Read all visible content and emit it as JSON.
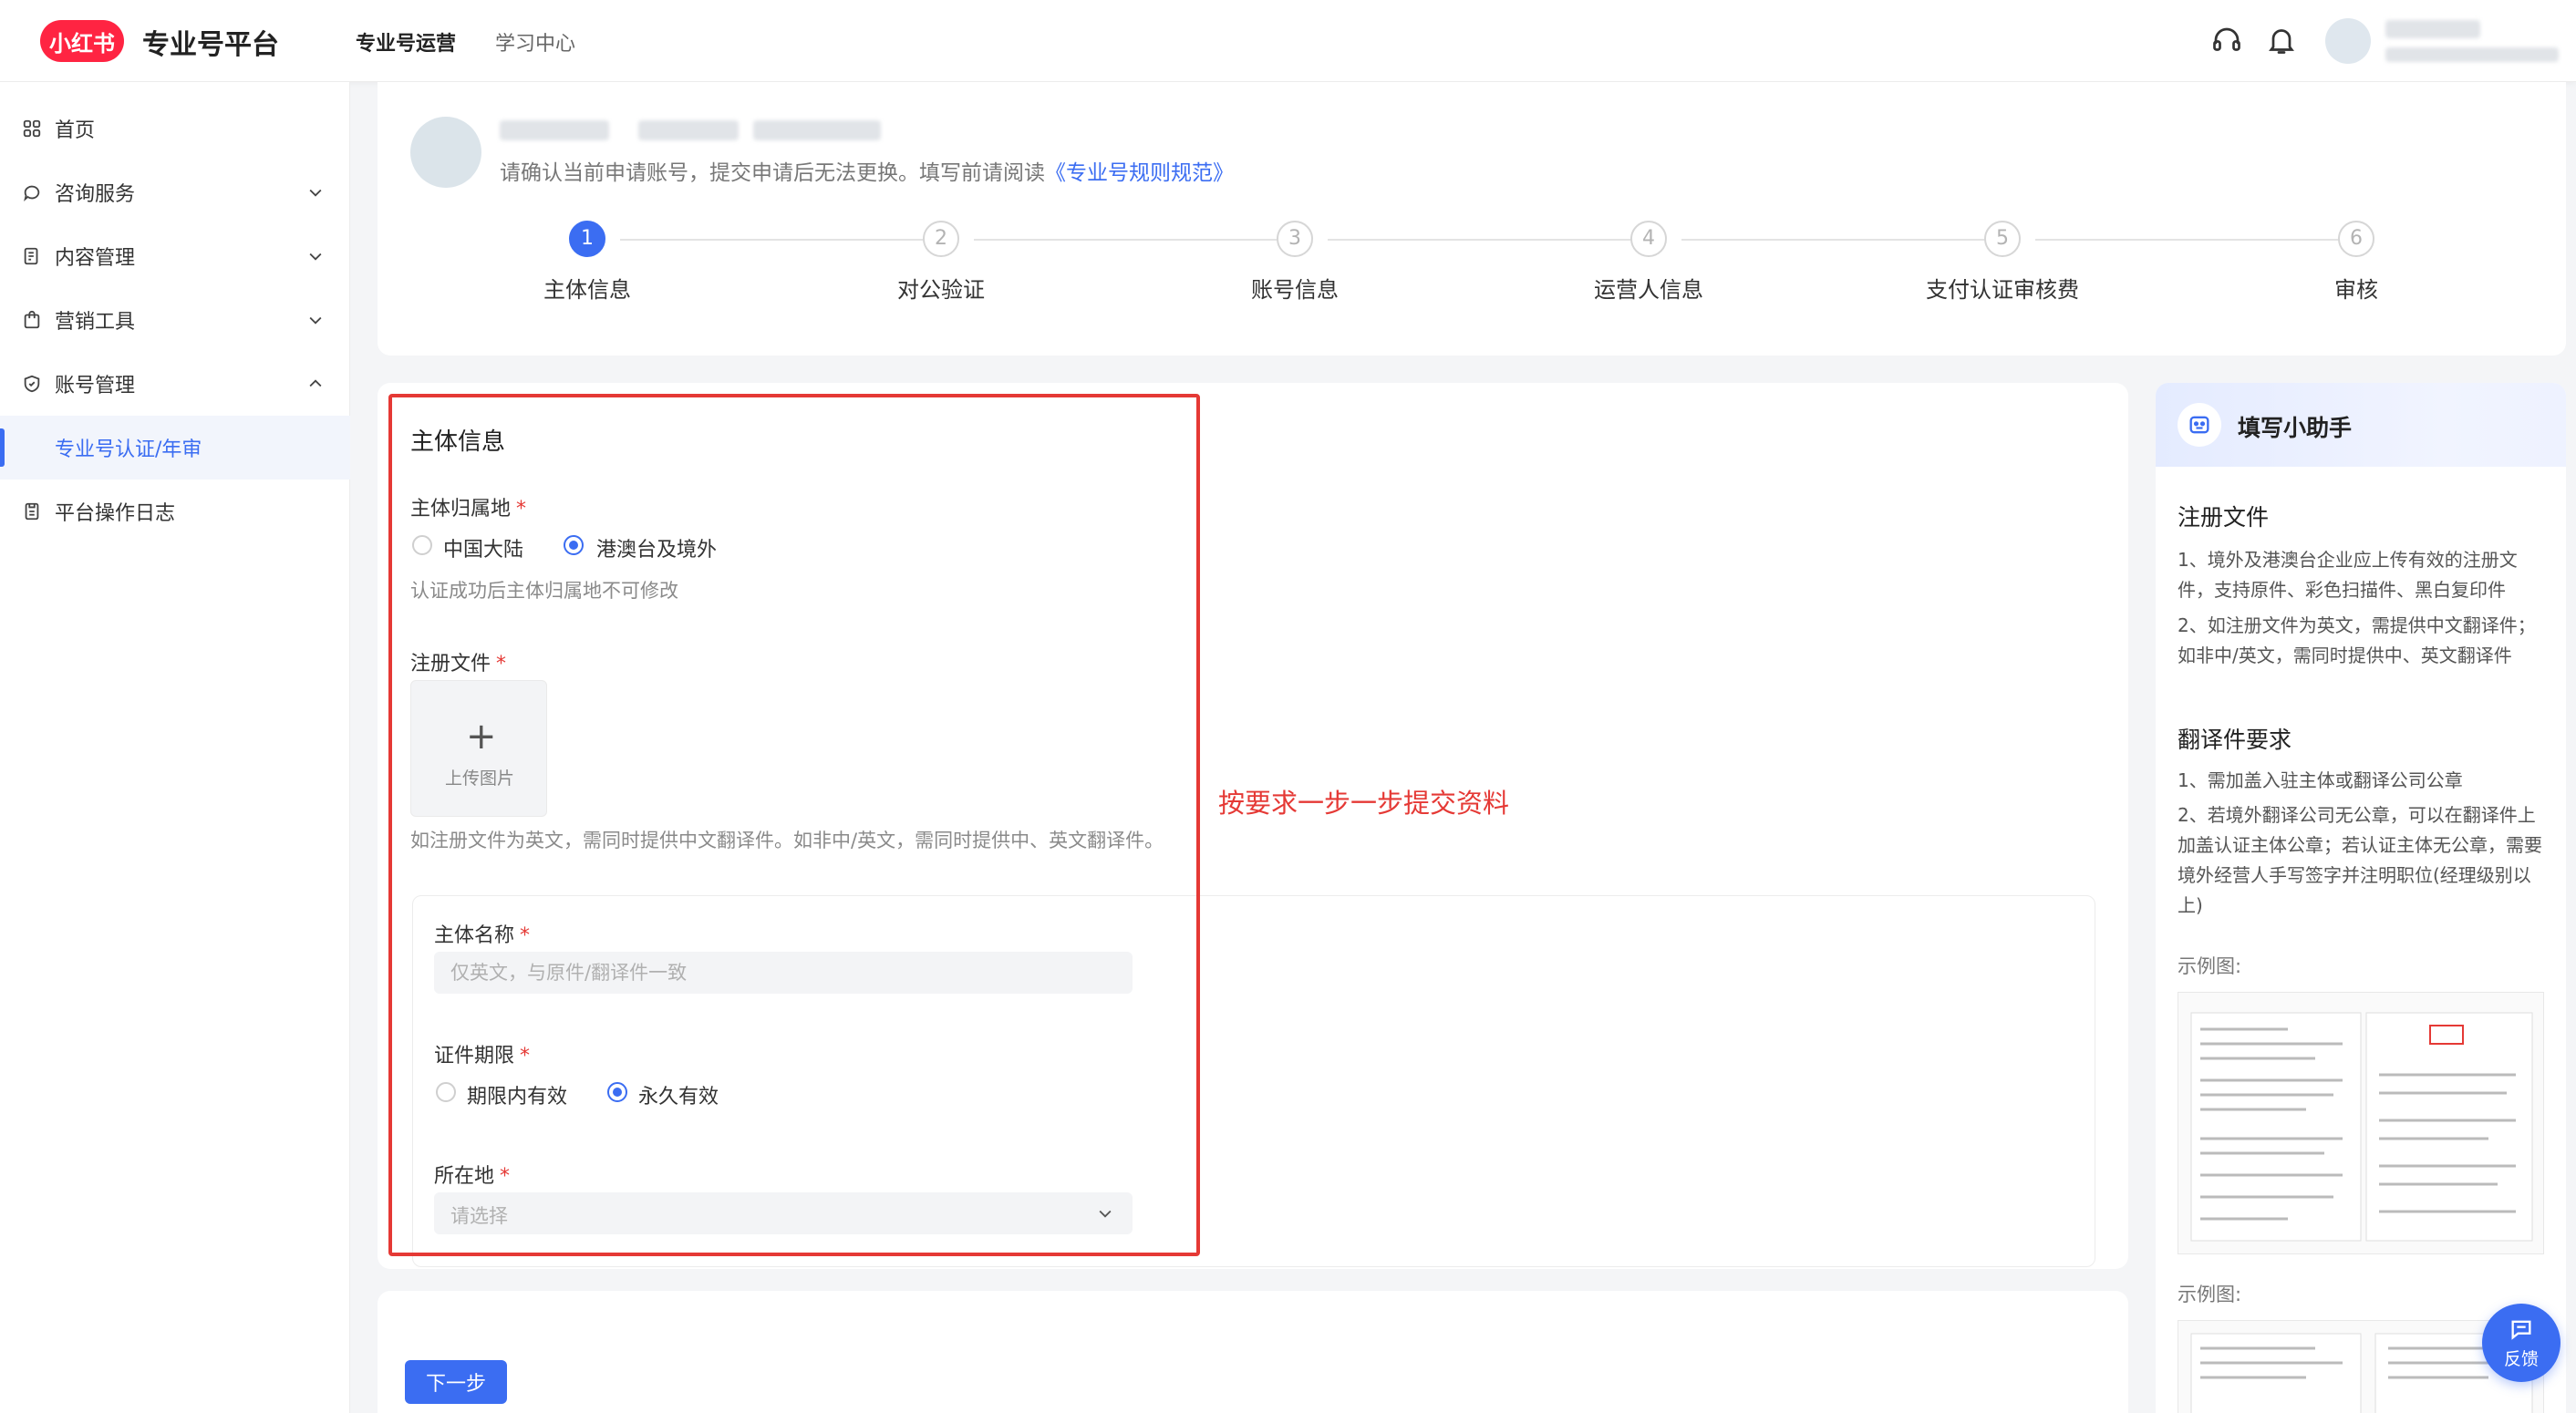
{
  "header": {
    "logo_text": "小红书",
    "platform_title": "专业号平台",
    "nav": [
      {
        "label": "专业号运营",
        "active": true
      },
      {
        "label": "学习中心",
        "active": false
      }
    ]
  },
  "sidebar": {
    "items": [
      {
        "label": "首页",
        "icon": "grid-icon",
        "expandable": false
      },
      {
        "label": "咨询服务",
        "icon": "chat-icon",
        "expandable": true,
        "expanded": false
      },
      {
        "label": "内容管理",
        "icon": "document-icon",
        "expandable": true,
        "expanded": false
      },
      {
        "label": "营销工具",
        "icon": "bag-icon",
        "expandable": true,
        "expanded": false
      },
      {
        "label": "账号管理",
        "icon": "shield-icon",
        "expandable": true,
        "expanded": true
      },
      {
        "label": "专业号认证/年审",
        "sub": true,
        "active": true
      },
      {
        "label": "平台操作日志",
        "icon": "log-icon",
        "expandable": false
      }
    ]
  },
  "account": {
    "notice_prefix": "请确认当前申请账号，提交申请后无法更换。填写前请阅读",
    "notice_link": "《专业号规则规范》"
  },
  "steps": [
    {
      "number": "1",
      "label": "主体信息",
      "active": true
    },
    {
      "number": "2",
      "label": "对公验证",
      "active": false
    },
    {
      "number": "3",
      "label": "账号信息",
      "active": false
    },
    {
      "number": "4",
      "label": "运营人信息",
      "active": false
    },
    {
      "number": "5",
      "label": "支付认证审核费",
      "active": false
    },
    {
      "number": "6",
      "label": "审核",
      "active": false
    }
  ],
  "form": {
    "title": "主体信息",
    "region": {
      "label": "主体归属地",
      "required_mark": "*",
      "options": [
        {
          "label": "中国大陆",
          "selected": false
        },
        {
          "label": "港澳台及境外",
          "selected": true
        }
      ],
      "hint": "认证成功后主体归属地不可修改"
    },
    "reg_file": {
      "label": "注册文件",
      "required_mark": "*",
      "upload_icon": "plus-icon",
      "upload_label": "上传图片",
      "hint": "如注册文件为英文，需同时提供中文翻译件。如非中/英文，需同时提供中、英文翻译件。"
    },
    "entity_name": {
      "label": "主体名称",
      "required_mark": "*",
      "value": "",
      "placeholder": "仅英文，与原件/翻译件一致"
    },
    "validity": {
      "label": "证件期限",
      "required_mark": "*",
      "options": [
        {
          "label": "期限内有效",
          "selected": false
        },
        {
          "label": "永久有效",
          "selected": true
        }
      ]
    },
    "location": {
      "label": "所在地",
      "required_mark": "*",
      "placeholder": "请选择"
    },
    "next_button": "下一步"
  },
  "annotation": {
    "text": "按要求一步一步提交资料",
    "color": "#e53935"
  },
  "helper": {
    "title": "填写小助手",
    "sections": [
      {
        "heading": "注册文件",
        "lines": [
          "1、境外及港澳台企业应上传有效的注册文件，支持原件、彩色扫描件、黑白复印件",
          "2、如注册文件为英文，需提供中文翻译件；如非中/英文，需同时提供中、英文翻译件"
        ]
      },
      {
        "heading": "翻译件要求",
        "lines": [
          "1、需加盖入驻主体或翻译公司公章",
          "2、若境外翻译公司无公章，可以在翻译件上加盖认证主体公章；若认证主体无公章，需要境外经营人手写签字并注明职位(经理级别以上)"
        ]
      }
    ],
    "example_label_1": "示例图:",
    "example_label_2": "示例图:"
  },
  "feedback": {
    "label": "反馈"
  },
  "colors": {
    "brand_red": "#ff2442",
    "accent_blue": "#3b6df2",
    "annotation_red": "#e53935"
  }
}
